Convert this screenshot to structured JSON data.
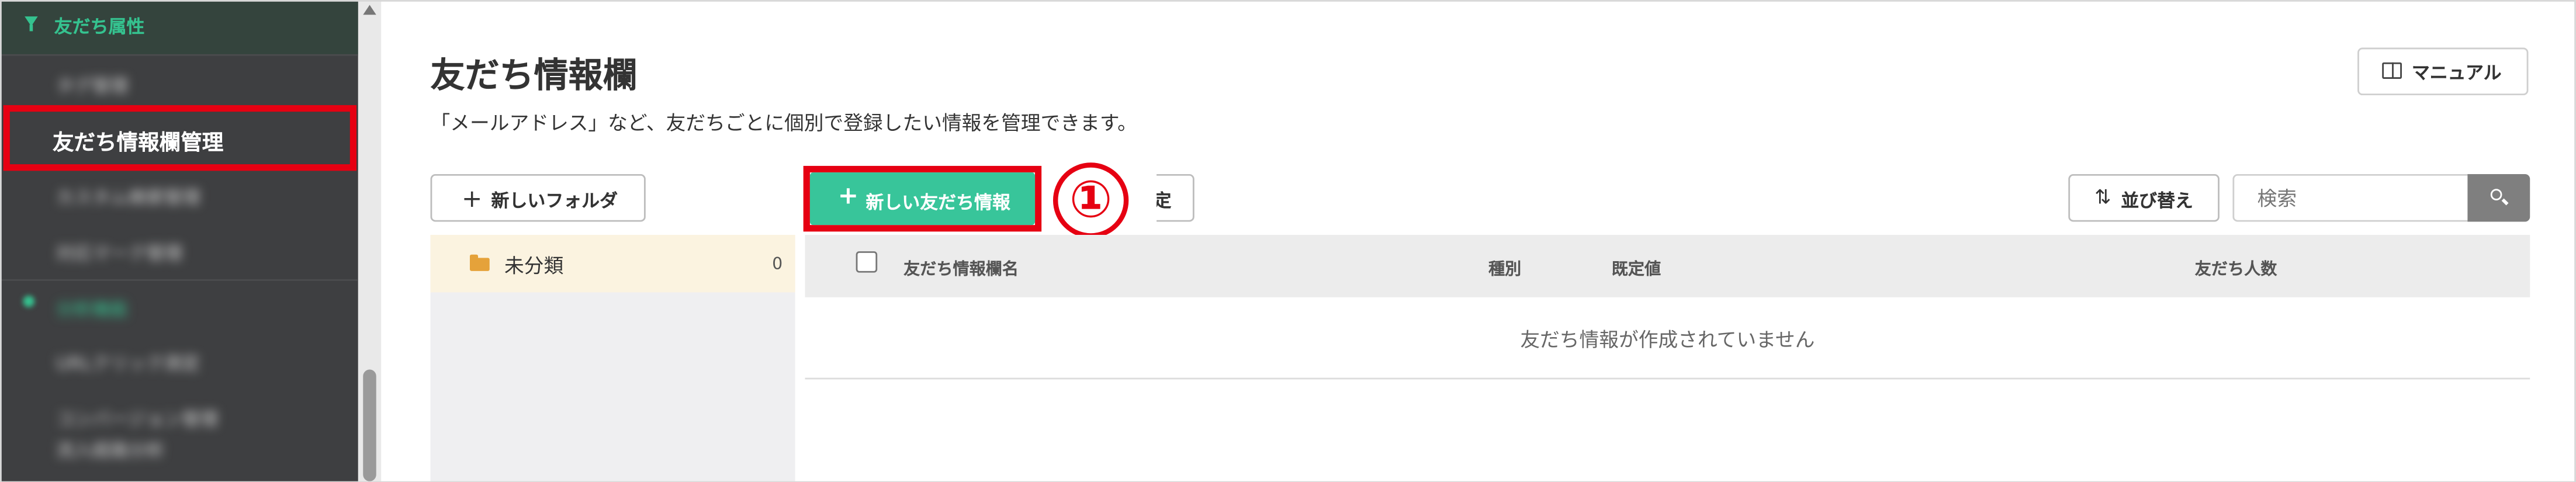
{
  "sidebar": {
    "section_label": "友だち属性",
    "items": [
      {
        "label": "タグ管理",
        "blurred": true
      },
      {
        "label": "友だち情報欄管理",
        "active": true
      },
      {
        "label": "カスタム検索管理",
        "blurred": true
      },
      {
        "label": "対応マーク管理",
        "blurred": true
      },
      {
        "label": "分析機能",
        "blurred": true
      },
      {
        "label": "URLクリック測定",
        "blurred": true
      },
      {
        "label": "コンバージョン管理",
        "blurred": true
      },
      {
        "label": "流入経路分析",
        "blurred": true
      }
    ]
  },
  "header": {
    "title": "友だち情報欄",
    "description": "「メールアドレス」など、友だちごとに個別で登録したい情報を管理できます。",
    "manual_label": "マニュアル",
    "manual_icon": "book-icon"
  },
  "toolbar": {
    "new_folder_label": "新しいフォルダ",
    "new_info_label": "新しい友だち情報",
    "hidden_button_tail": "定",
    "sort_label": "並び替え",
    "search_placeholder": "検索",
    "callout_number": "①",
    "accent_color": "#38c59a",
    "highlight_color": "#e60012"
  },
  "folders": [
    {
      "name": "未分類",
      "count": "0"
    }
  ],
  "table": {
    "columns": [
      "友だち情報欄名",
      "種別",
      "既定値",
      "友だち人数"
    ],
    "empty_message": "友だち情報が作成されていません"
  }
}
